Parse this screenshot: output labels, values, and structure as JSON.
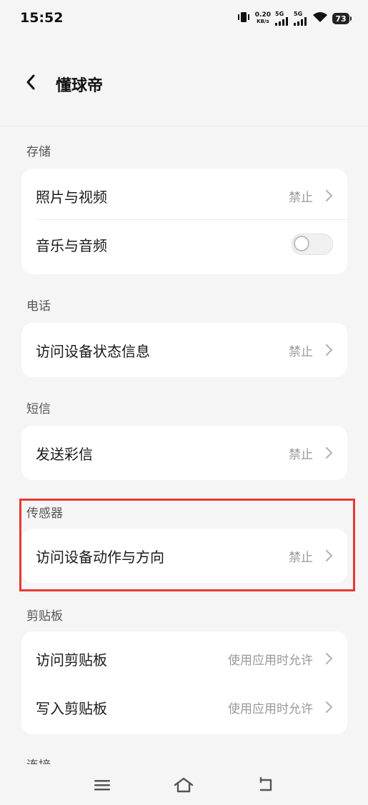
{
  "status_bar": {
    "time": "15:52",
    "net_speed_value": "0.20",
    "net_speed_unit": "KB/s",
    "sim1_label": "5G",
    "sim2_label": "5G",
    "battery": "73"
  },
  "header": {
    "title": "懂球帝"
  },
  "sections": {
    "storage": {
      "title": "存储",
      "items": [
        {
          "label": "照片与视频",
          "value": "禁止"
        },
        {
          "label": "音乐与音频",
          "toggle": false
        }
      ]
    },
    "phone": {
      "title": "电话",
      "items": [
        {
          "label": "访问设备状态信息",
          "value": "禁止"
        }
      ]
    },
    "sms": {
      "title": "短信",
      "items": [
        {
          "label": "发送彩信",
          "value": "禁止"
        }
      ]
    },
    "sensors": {
      "title": "传感器",
      "items": [
        {
          "label": "访问设备动作与方向",
          "value": "禁止"
        }
      ]
    },
    "clipboard": {
      "title": "剪贴板",
      "items": [
        {
          "label": "访问剪贴板",
          "value": "使用应用时允许"
        },
        {
          "label": "写入剪贴板",
          "value": "使用应用时允许"
        }
      ]
    },
    "connection": {
      "title": "连接"
    }
  },
  "colors": {
    "highlight": "#e53935",
    "background": "#f5f5f5",
    "card": "#ffffff"
  }
}
